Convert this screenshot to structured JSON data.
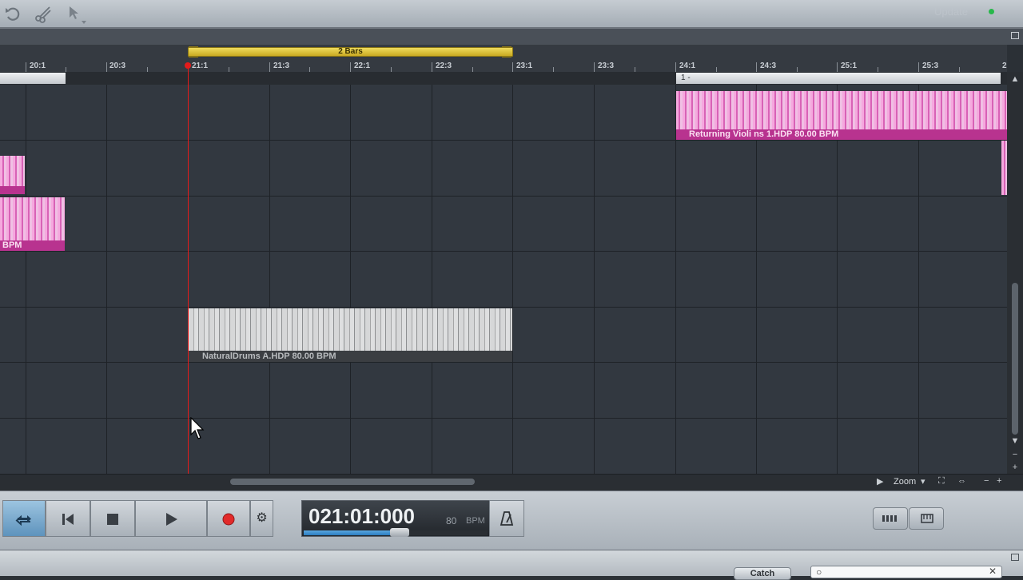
{
  "toolbar": {
    "icons": [
      "undo-icon",
      "scissors-icon",
      "pointer-tool-icon"
    ],
    "update_label": "Update",
    "status_color": "#27b84a"
  },
  "timeline": {
    "range_label": "2 Bars",
    "ticks": [
      "20:1",
      "20:3",
      "21:1",
      "21:3",
      "22:1",
      "22:3",
      "23:1",
      "23:3",
      "24:1",
      "24:3",
      "25:1",
      "25:3",
      "2"
    ],
    "region_label": "1 -"
  },
  "clips": {
    "violins_label": "Returning Violi ns 1.HDP  80.00 BPM",
    "left_clip_label": "BPM",
    "drums_label": "NaturalDrums A.HDP  80.00 BPM"
  },
  "bottom_bar": {
    "zoom_label": "Zoom"
  },
  "transport": {
    "time": "021:01:000",
    "tempo": "80",
    "tempo_unit": "BPM",
    "position_fraction": 0.52
  },
  "bottom_panel": {
    "button_label": "Catch"
  },
  "colors": {
    "playhead": "#e31b1b",
    "range_bar": "#e8cc3a",
    "clip_pink": "#d862b6",
    "clip_gray": "#a5a6a7",
    "loop_active": "#5e93bd"
  }
}
